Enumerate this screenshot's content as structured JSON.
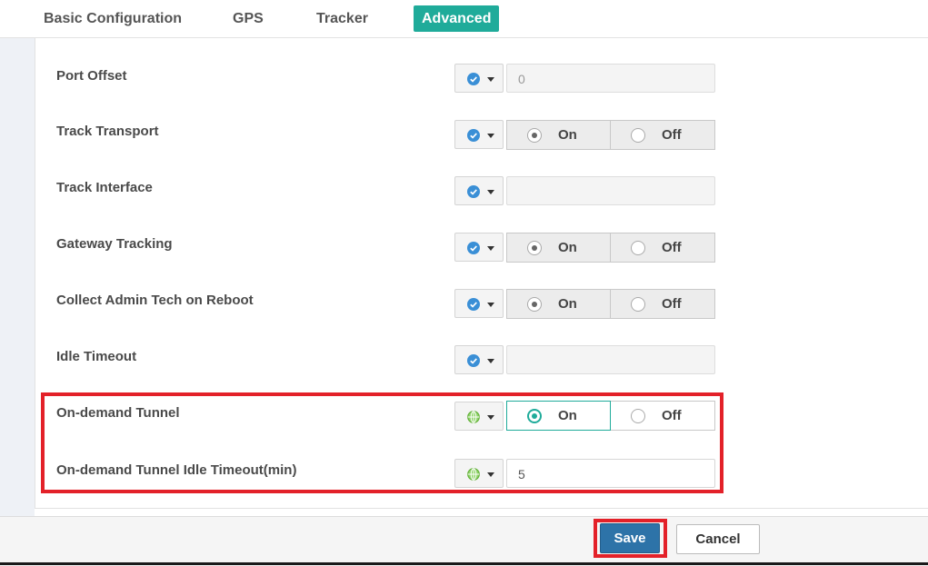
{
  "tabs": [
    {
      "label": "Basic Configuration",
      "active": false
    },
    {
      "label": "GPS",
      "active": false
    },
    {
      "label": "Tracker",
      "active": false
    },
    {
      "label": "Advanced",
      "active": true
    }
  ],
  "rows": [
    {
      "label": "Port Offset",
      "scope_icon": "check-circle-icon",
      "control": "text",
      "value": "0"
    },
    {
      "label": "Track Transport",
      "scope_icon": "check-circle-icon",
      "control": "radio",
      "on_label": "On",
      "off_label": "Off",
      "selected": "On"
    },
    {
      "label": "Track Interface",
      "scope_icon": "check-circle-icon",
      "control": "text",
      "value": ""
    },
    {
      "label": "Gateway Tracking",
      "scope_icon": "check-circle-icon",
      "control": "radio",
      "on_label": "On",
      "off_label": "Off",
      "selected": "On"
    },
    {
      "label": "Collect Admin Tech on Reboot",
      "scope_icon": "check-circle-icon",
      "control": "radio",
      "on_label": "On",
      "off_label": "Off",
      "selected": "On"
    },
    {
      "label": "Idle Timeout",
      "scope_icon": "check-circle-icon",
      "control": "text",
      "value": ""
    },
    {
      "label": "On-demand Tunnel",
      "scope_icon": "globe-icon",
      "control": "radio",
      "on_label": "On",
      "off_label": "Off",
      "selected": "On"
    },
    {
      "label": "On-demand Tunnel Idle Timeout(min)",
      "scope_icon": "globe-icon",
      "control": "text",
      "value": "5"
    }
  ],
  "footer": {
    "save_label": "Save",
    "cancel_label": "Cancel"
  },
  "colors": {
    "accent": "#1fab9a",
    "highlight": "#e32129",
    "save_button": "#2d73a8",
    "check_icon": "#3a8fd6",
    "globe_icon": "#6cbf3a"
  }
}
